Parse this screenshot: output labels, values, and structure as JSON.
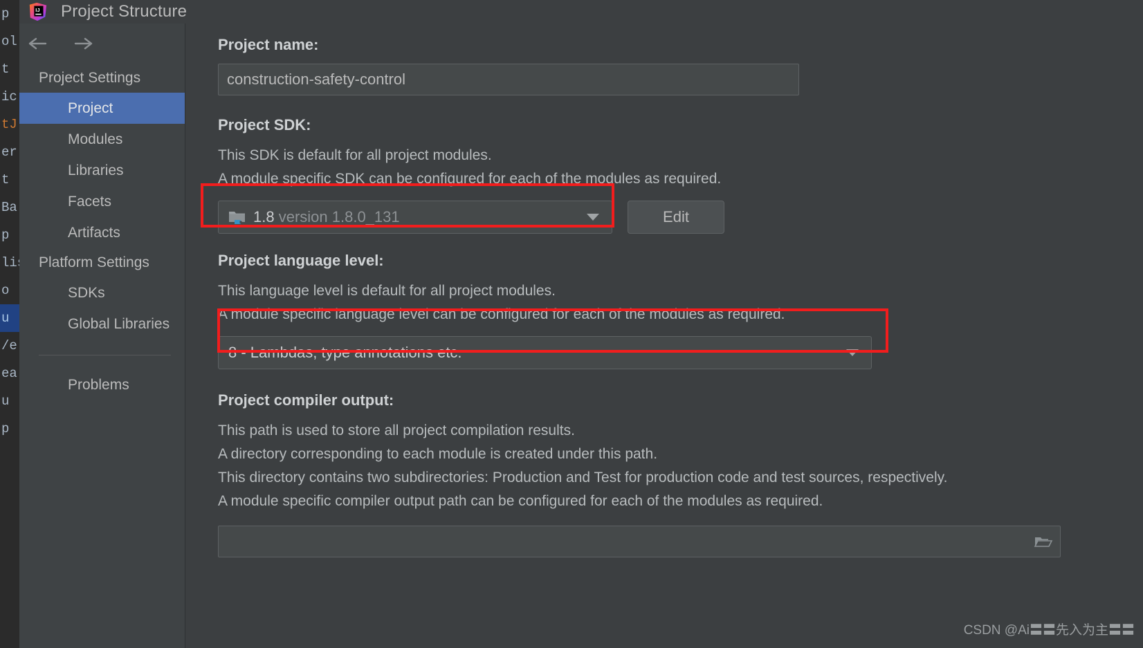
{
  "window": {
    "title": "Project Structure",
    "logo_icon": "intellij-idea-logo"
  },
  "sidebar": {
    "nav": {
      "back_icon": "arrow-left-icon",
      "forward_icon": "arrow-right-icon"
    },
    "groups": [
      {
        "title": "Project Settings",
        "items": [
          {
            "label": "Project",
            "selected": true
          },
          {
            "label": "Modules",
            "selected": false
          },
          {
            "label": "Libraries",
            "selected": false
          },
          {
            "label": "Facets",
            "selected": false
          },
          {
            "label": "Artifacts",
            "selected": false
          }
        ]
      },
      {
        "title": "Platform Settings",
        "items": [
          {
            "label": "SDKs",
            "selected": false
          },
          {
            "label": "Global Libraries",
            "selected": false
          }
        ]
      }
    ],
    "problems_label": "Problems"
  },
  "main": {
    "project_name": {
      "label": "Project name:",
      "value": "construction-safety-control"
    },
    "project_sdk": {
      "label": "Project SDK:",
      "description_lines": [
        "This SDK is default for all project modules.",
        "A module specific SDK can be configured for each of the modules as required."
      ],
      "selected_name": "1.8",
      "selected_version": "version 1.8.0_131",
      "icon": "java-sdk-folder-icon",
      "dropdown_icon": "chevron-down-icon",
      "edit_button": "Edit"
    },
    "language_level": {
      "label": "Project language level:",
      "description_lines": [
        "This language level is default for all project modules.",
        "A module specific language level can be configured for each of the modules as required."
      ],
      "selected": "8 - Lambdas, type annotations etc.",
      "dropdown_icon": "chevron-down-icon"
    },
    "compiler_output": {
      "label": "Project compiler output:",
      "description_lines": [
        "This path is used to store all project compilation results.",
        "A directory corresponding to each module is created under this path.",
        "This directory contains two subdirectories: Production and Test for production code and test sources, respectively.",
        "A module specific compiler output path can be configured for each of the modules as required."
      ],
      "value": "",
      "browse_icon": "folder-browse-icon"
    }
  },
  "annotations": {
    "color": "#f21d1d",
    "boxes": [
      {
        "name": "project-sdk-highlight"
      },
      {
        "name": "language-level-highlight"
      }
    ]
  },
  "background_editor": {
    "lines": [
      "p",
      "ol",
      "t",
      "ic",
      "tJ",
      "er",
      "t",
      "Ba",
      "p",
      "lis",
      "o",
      "u",
      "/e",
      "ea",
      "u",
      "p"
    ]
  },
  "watermark": {
    "text": "CSDN @Ai〓〓先入为主〓〓"
  }
}
